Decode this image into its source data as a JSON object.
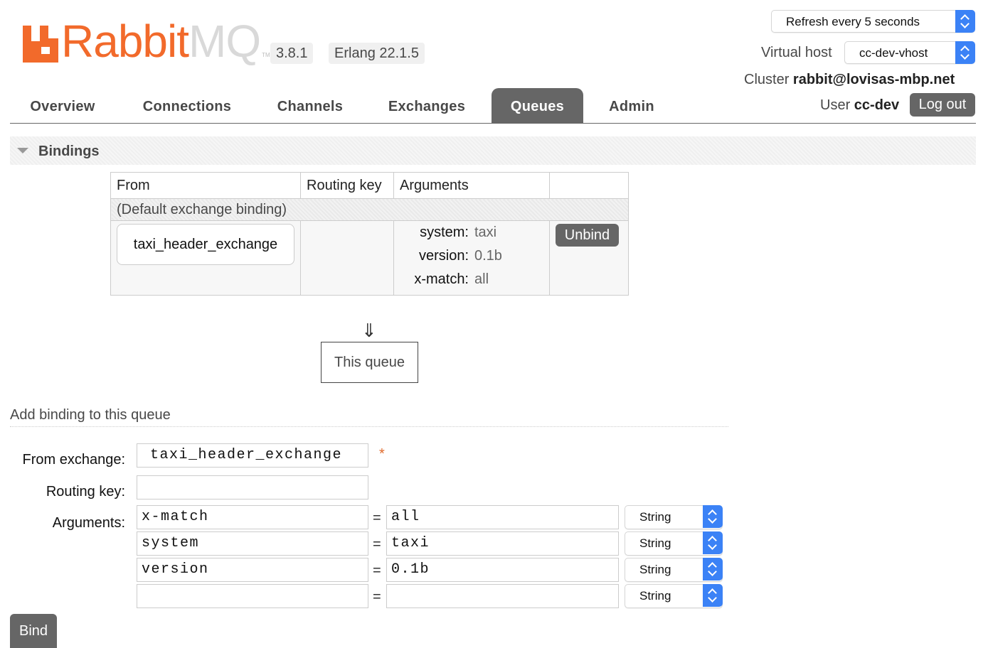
{
  "header": {
    "logo": {
      "text_main": "Rabbit",
      "text_accent": "MQ",
      "tm": "TM"
    },
    "version": "3.8.1",
    "erlang": "Erlang 22.1.5",
    "refresh_select": "Refresh every 5 seconds",
    "virtual_host_label": "Virtual host",
    "virtual_host_value": "cc-dev-vhost",
    "cluster_label": "Cluster",
    "cluster_value": "rabbit@lovisas-mbp.net",
    "user_label": "User",
    "user_value": "cc-dev",
    "logout_label": "Log out"
  },
  "nav": {
    "tabs": [
      {
        "label": "Overview",
        "active": false
      },
      {
        "label": "Connections",
        "active": false
      },
      {
        "label": "Channels",
        "active": false
      },
      {
        "label": "Exchanges",
        "active": false
      },
      {
        "label": "Queues",
        "active": true
      },
      {
        "label": "Admin",
        "active": false
      }
    ]
  },
  "bindings": {
    "section_title": "Bindings",
    "columns": [
      "From",
      "Routing key",
      "Arguments",
      ""
    ],
    "default_binding_label": "(Default exchange binding)",
    "rows": [
      {
        "from": "taxi_header_exchange",
        "routing_key": "",
        "arguments": [
          {
            "key": "system:",
            "value": "taxi"
          },
          {
            "key": "version:",
            "value": "0.1b"
          },
          {
            "key": "x-match:",
            "value": "all"
          }
        ],
        "action_label": "Unbind"
      }
    ],
    "arrow": "⇓",
    "this_queue_label": "This queue"
  },
  "add_binding": {
    "title": "Add binding to this queue",
    "from_exchange_label": "From exchange:",
    "from_exchange_value": "taxi_header_exchange",
    "required_marker": "*",
    "routing_key_label": "Routing key:",
    "routing_key_value": "",
    "arguments_label": "Arguments:",
    "equals": "=",
    "arguments": [
      {
        "key": "x-match",
        "value": "all",
        "type": "String"
      },
      {
        "key": "system",
        "value": "taxi",
        "type": "String"
      },
      {
        "key": "version",
        "value": "0.1b",
        "type": "String"
      },
      {
        "key": "",
        "value": "",
        "type": "String"
      }
    ],
    "bind_label": "Bind"
  },
  "colors": {
    "brand_orange": "#f26a2b",
    "active_tab": "#666666",
    "select_accent": "#3b82f6"
  }
}
